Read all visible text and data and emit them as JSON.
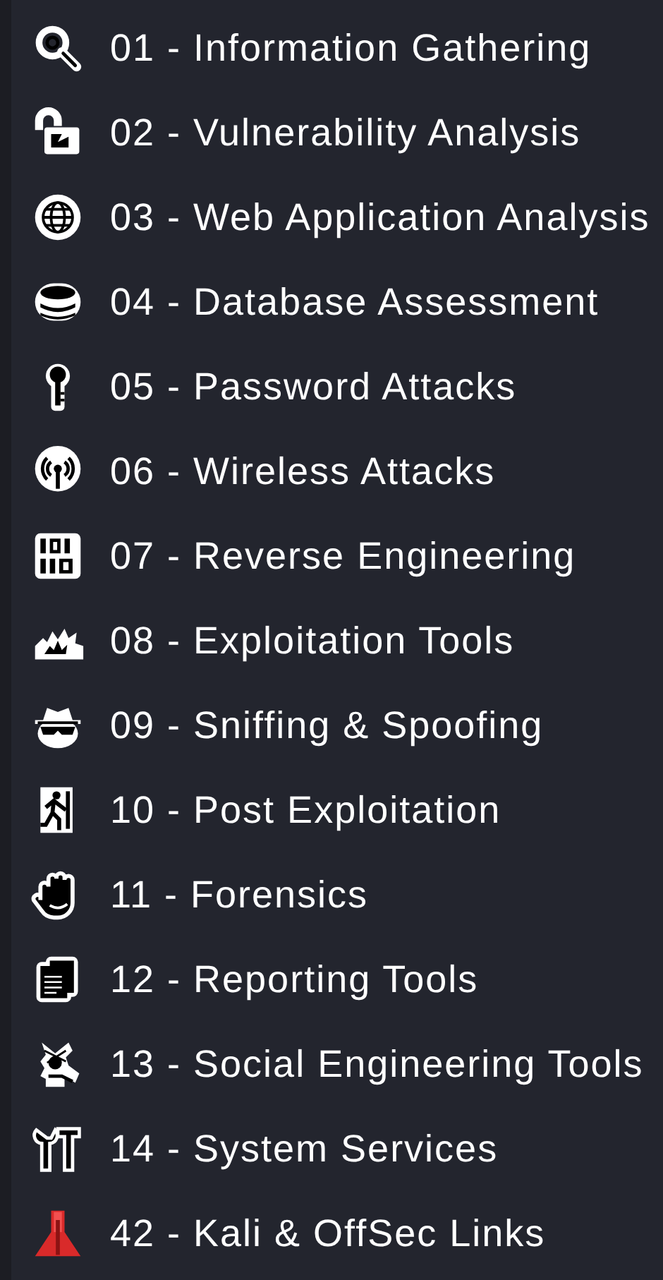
{
  "menu": {
    "items": [
      {
        "label": "01 - Information Gathering"
      },
      {
        "label": "02 - Vulnerability Analysis"
      },
      {
        "label": "03 - Web Application Analysis"
      },
      {
        "label": "04 - Database Assessment"
      },
      {
        "label": "05 - Password Attacks"
      },
      {
        "label": "06 - Wireless Attacks"
      },
      {
        "label": "07 - Reverse Engineering"
      },
      {
        "label": "08 - Exploitation Tools"
      },
      {
        "label": "09 - Sniffing & Spoofing"
      },
      {
        "label": "10 - Post Exploitation"
      },
      {
        "label": "11 - Forensics"
      },
      {
        "label": "12 - Reporting Tools"
      },
      {
        "label": "13 - Social Engineering Tools"
      },
      {
        "label": "14 - System Services"
      },
      {
        "label": "42 - Kali & OffSec Links"
      }
    ]
  }
}
